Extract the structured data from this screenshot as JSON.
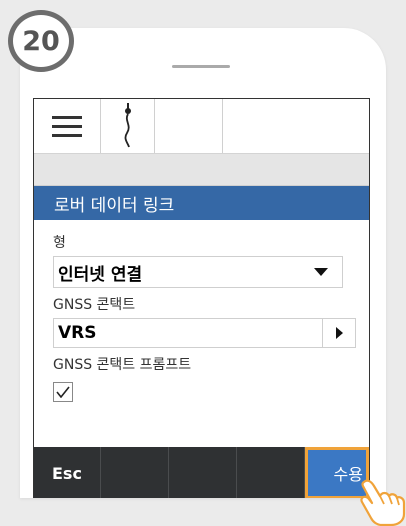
{
  "step_badge": "20",
  "screen": {
    "title": "로버 데이터 링크",
    "fields": {
      "type_label": "형",
      "type_value": "인터넷 연결",
      "contact_label": "GNSS 콘택트",
      "contact_value": "VRS",
      "prompt_label": "GNSS 콘택트 프롬프트",
      "prompt_checked": true
    },
    "buttons": {
      "esc": "Esc",
      "accept": "수용"
    }
  },
  "icons": {
    "menu": "hamburger-menu-icon",
    "rover": "rover-antenna-icon",
    "dropdown": "dropdown-triangle-icon",
    "picker": "right-arrow-icon",
    "check": "checkmark-icon",
    "pointer": "pointing-hand-icon"
  },
  "colors": {
    "title_bar": "#3568a6",
    "bottom_bar": "#2f3133",
    "accept_button": "#3b78c4",
    "highlight": "#f0a33a"
  }
}
